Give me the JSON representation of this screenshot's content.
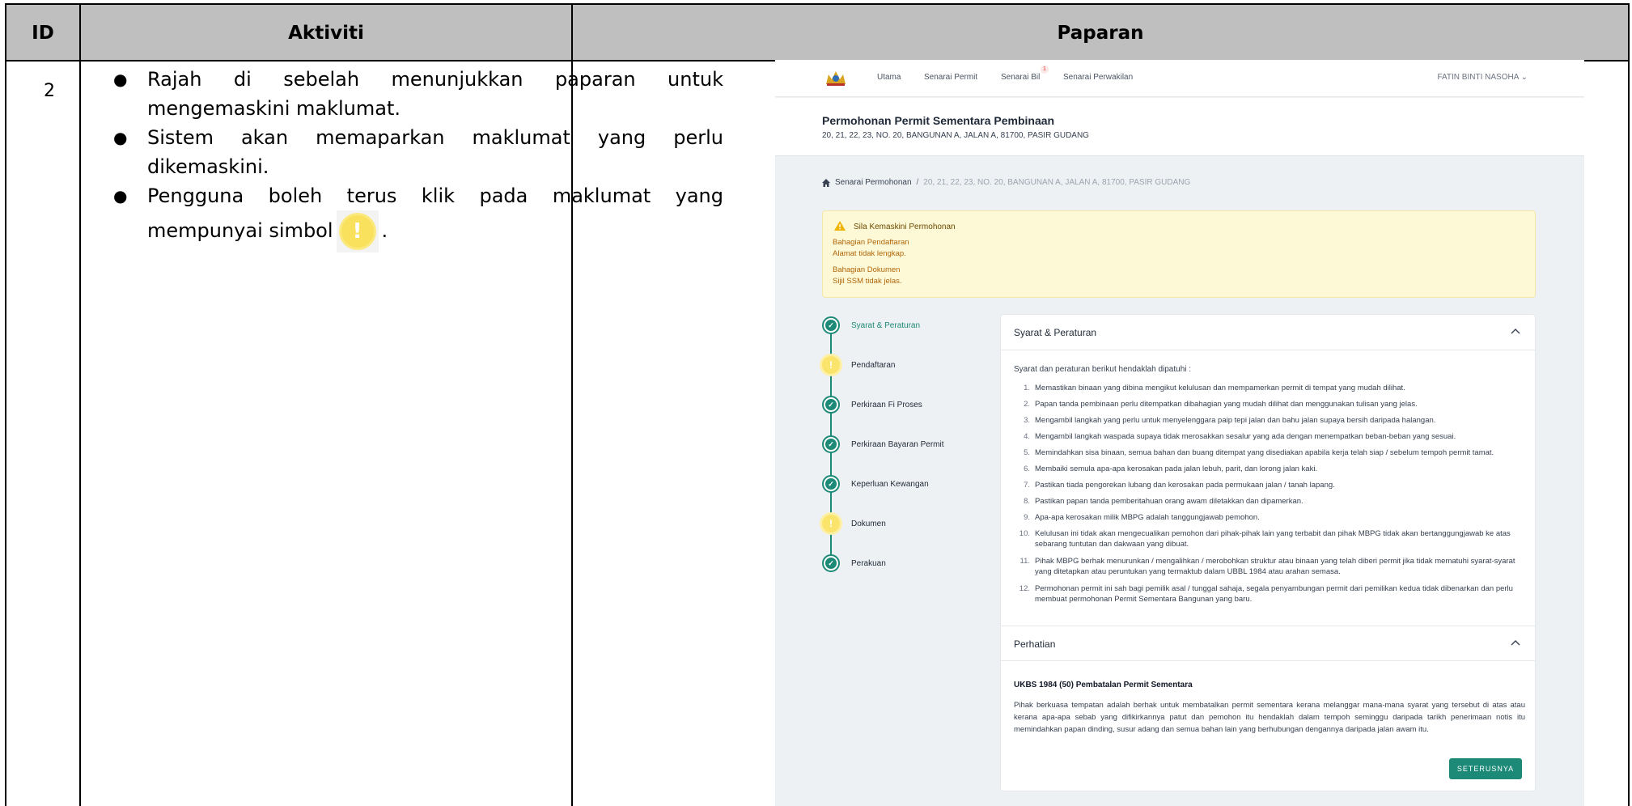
{
  "table": {
    "headers": {
      "id": "ID",
      "activity": "Aktiviti",
      "display": "Paparan"
    },
    "row": {
      "id": "2",
      "activities": [
        "Rajah di sebelah menunjukkan paparan untuk mengemaskini maklumat.",
        "Sistem akan memaparkan maklumat yang perlu dikemaskini.",
        "Pengguna boleh terus klik pada maklumat yang mempunyai simbol"
      ],
      "activity_end": "."
    }
  },
  "app": {
    "nav": {
      "items": [
        "Utama",
        "Senarai Permit",
        "Senarai Bil",
        "Senarai Perwakilan"
      ],
      "badge": "1",
      "user": "FATIN BINTI NASOHA"
    },
    "title": "Permohonan Permit Sementara Pembinaan",
    "address": "20, 21, 22, 23, NO. 20, BANGUNAN A, JALAN A, 81700, PASIR GUDANG",
    "breadcrumb": {
      "root": "Senarai Permohonan",
      "sep": "/",
      "current": "20, 21, 22, 23, NO. 20, BANGUNAN A, JALAN A, 81700, PASIR GUDANG"
    },
    "alert": {
      "title": "Sila Kemaskini Permohonan",
      "lines": [
        "Bahagian Pendaftaran",
        "Alamat tidak lengkap.",
        "Bahagian Dokumen",
        "Sijil SSM tidak jelas."
      ]
    },
    "steps": [
      {
        "label": "Syarat & Peraturan",
        "status": "done"
      },
      {
        "label": "Pendaftaran",
        "status": "warn"
      },
      {
        "label": "Perkiraan Fi Proses",
        "status": "done"
      },
      {
        "label": "Perkiraan Bayaran Permit",
        "status": "done"
      },
      {
        "label": "Keperluan Kewangan",
        "status": "done"
      },
      {
        "label": "Dokumen",
        "status": "warn"
      },
      {
        "label": "Perakuan",
        "status": "done"
      }
    ],
    "terms": {
      "title": "Syarat & Peraturan",
      "intro": "Syarat dan peraturan berikut hendaklah dipatuhi :",
      "rules": [
        "Memastikan binaan yang dibina mengikut kelulusan dan mempamerkan permit di tempat yang mudah dilihat.",
        "Papan tanda pembinaan perlu ditempatkan dibahagian yang mudah dilihat dan menggunakan tulisan yang jelas.",
        "Mengambil langkah yang perlu untuk menyelenggara paip tepi jalan dan bahu jalan supaya bersih daripada halangan.",
        "Mengambil langkah waspada supaya tidak merosakkan sesalur yang ada dengan menempatkan beban-beban yang sesuai.",
        "Memindahkan sisa binaan, semua bahan dan buang ditempat yang disediakan apabila kerja telah siap / sebelum tempoh permit tamat.",
        "Membaiki semula apa-apa kerosakan pada jalan lebuh, parit, dan lorong jalan kaki.",
        "Pastikan tiada pengorekan lubang dan kerosakan pada permukaan jalan / tanah lapang.",
        "Pastikan papan tanda pemberitahuan orang awam diletakkan dan dipamerkan.",
        "Apa-apa kerosakan milik MBPG adalah tanggungjawab pemohon.",
        "Kelulusan ini tidak akan mengecualikan pemohon dari pihak-pihak lain yang terbabit dan pihak MBPG tidak akan bertanggungjawab ke atas sebarang tuntutan dan dakwaan yang dibuat.",
        "Pihak MBPG berhak menurunkan / mengalihkan / merobohkan struktur atau binaan yang telah diberi permit jika tidak mematuhi syarat-syarat yang ditetapkan atau peruntukan yang termaktub dalam UBBL 1984 atau arahan semasa.",
        "Permohonan permit ini sah bagi pemilik asal / tunggal sahaja, segala penyambungan permit dari pemilikan kedua tidak dibenarkan dan perlu membuat permohonan Permit Sementara Bangunan yang baru."
      ],
      "numbers": [
        "1.",
        "2.",
        "3.",
        "4.",
        "5.",
        "6.",
        "7.",
        "8.",
        "9.",
        "10.",
        "11.",
        "12."
      ]
    },
    "notice": {
      "title": "Perhatian",
      "subtitle": "UKBS 1984 (50) Pembatalan Permit Sementara",
      "body": "Pihak berkuasa tempatan adalah berhak untuk membatalkan permit sementara kerana melanggar mana-mana syarat yang tersebut di atas atau kerana apa-apa sebab yang difikirkannya patut dan pemohon itu hendaklah dalam tempoh seminggu daripada tarikh penerimaan notis itu memindahkan papan dinding, susur adang dan semua bahan lain yang berhubungan dengannya daripada jalan awam itu."
    },
    "next_button": "SETERUSNYA",
    "colors": {
      "accent": "#1d8a78",
      "warning": "#fbe46b",
      "alert_bg": "#fdf8d5"
    }
  }
}
